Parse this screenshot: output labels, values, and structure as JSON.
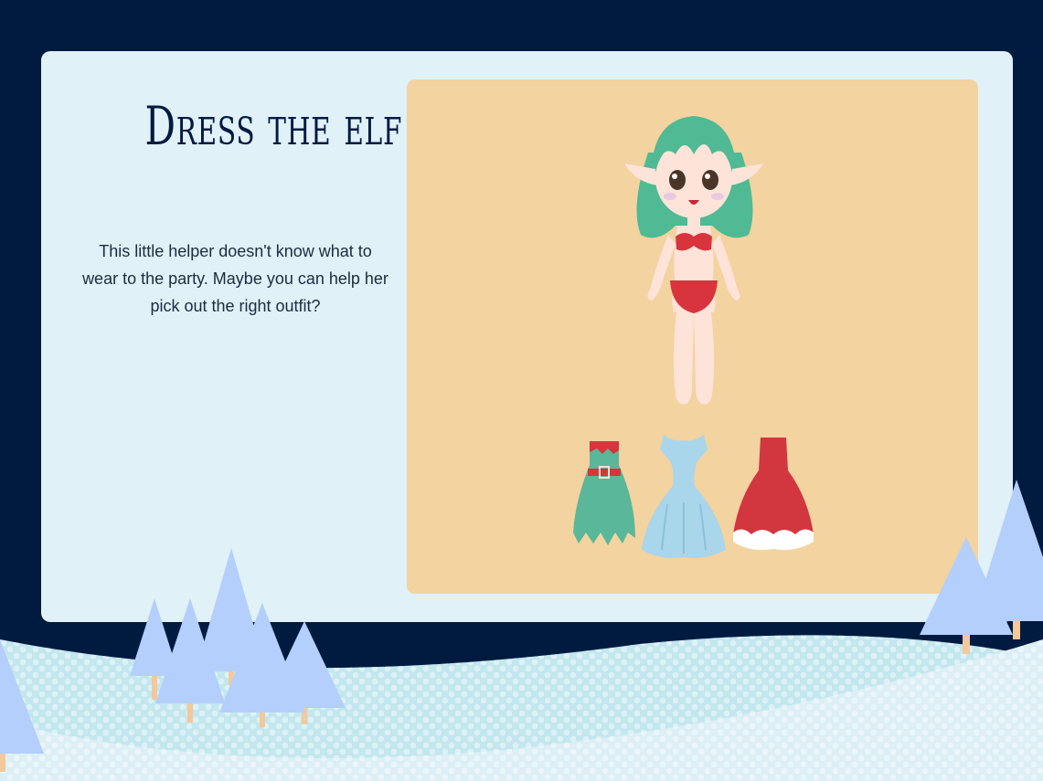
{
  "page": {
    "title": "Dress the elf!",
    "description": "This little helper doesn't know what to wear to the party. Maybe you can help her pick out the right outfit?"
  },
  "outfits": [
    {
      "name": "green-elf-dress",
      "color": "#5ab79a"
    },
    {
      "name": "light-blue-gown",
      "color": "#a9d6ea"
    },
    {
      "name": "red-dress",
      "color": "#d2363f"
    }
  ],
  "colors": {
    "background": "#001a40",
    "card": "#e0f1f7",
    "stage": "#f3d3a0",
    "hair": "#4fba93",
    "skin": "#fde3d8",
    "swimsuit": "#d8343d",
    "tree": "#b4cffb"
  }
}
